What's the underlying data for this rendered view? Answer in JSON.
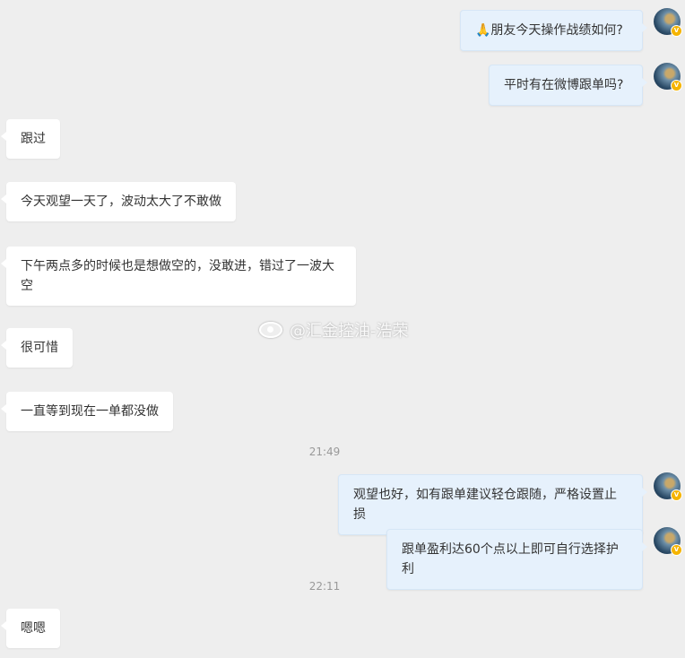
{
  "messages": [
    {
      "side": "right",
      "text": "🙏朋友今天操作战绩如何?"
    },
    {
      "side": "right",
      "text": "平时有在微博跟单吗?"
    },
    {
      "side": "left",
      "text": "跟过"
    },
    {
      "side": "left",
      "text": "今天观望一天了，波动太大了不敢做"
    },
    {
      "side": "left",
      "text": "下午两点多的时候也是想做空的，没敢进，错过了一波大空"
    },
    {
      "side": "left",
      "text": "很可惜"
    },
    {
      "side": "left",
      "text": "一直等到现在一单都没做"
    },
    {
      "side": "right",
      "text": "观望也好，如有跟单建议轻仓跟随，严格设置止损"
    },
    {
      "side": "right",
      "text": "跟单盈利达60个点以上即可自行选择护利"
    },
    {
      "side": "left",
      "text": "嗯嗯"
    }
  ],
  "timestamps": [
    "21:49",
    "22:11"
  ],
  "watermark": "@汇金控油-浩荣",
  "avatar_badge": "V",
  "colors": {
    "background": "#eeeeee",
    "left_bubble": "#ffffff",
    "right_bubble": "#e6f1fc",
    "timestamp": "#999999",
    "badge": "#f5b400"
  }
}
